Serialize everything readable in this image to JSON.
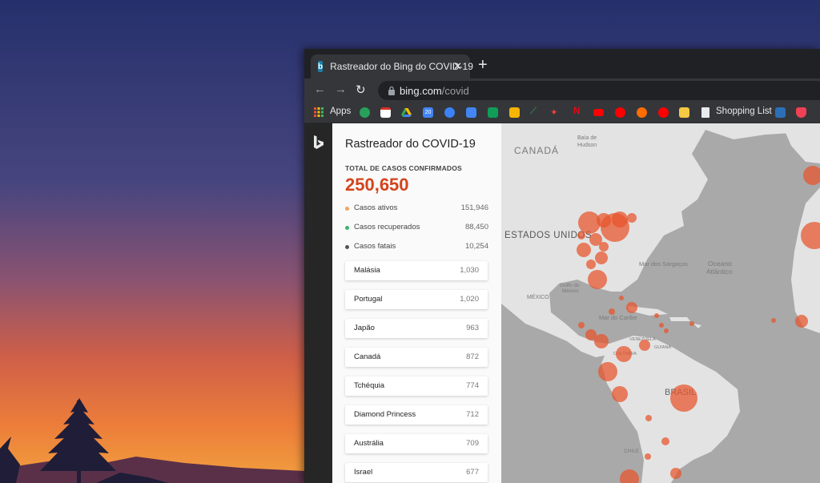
{
  "browser": {
    "tab_title": "Rastreador do Bing do COVID-19",
    "url_host": "bing.com",
    "url_path": "/covid"
  },
  "bookmarks": {
    "apps_label": "Apps",
    "shopping_label": "Shopping List",
    "calendar_day": "20"
  },
  "panel": {
    "title": "Rastreador do COVID-19",
    "total_label": "TOTAL DE CASOS CONFIRMADOS",
    "total_value": "250,650",
    "stats": [
      {
        "label": "Casos ativos",
        "value": "151,946",
        "color": "#f0a35e"
      },
      {
        "label": "Casos recuperados",
        "value": "88,450",
        "color": "#3cb371"
      },
      {
        "label": "Casos fatais",
        "value": "10,254",
        "color": "#555555"
      }
    ],
    "countries": [
      {
        "name": "Malásia",
        "value": "1,030"
      },
      {
        "name": "Portugal",
        "value": "1,020"
      },
      {
        "name": "Japão",
        "value": "963"
      },
      {
        "name": "Canadá",
        "value": "872"
      },
      {
        "name": "Tchéquia",
        "value": "774"
      },
      {
        "name": "Diamond Princess",
        "value": "712"
      },
      {
        "name": "Austrália",
        "value": "709"
      },
      {
        "name": "Israel",
        "value": "677"
      }
    ]
  },
  "map": {
    "labels": {
      "canada": "CANADÁ",
      "baia": "Baía de",
      "hudson": "Hudson",
      "eua": "ESTADOS UNIDOS",
      "sargacos": "Mar dos Sargaços",
      "oceano": "Oceano",
      "atlantico": "Atlântico",
      "golfo1": "Golfo do",
      "golfo2": "México",
      "mexico": "MÉXICO",
      "caribe": "Mar do Caribe",
      "venezuela": "VENEZUELA",
      "guiana": "GUIANA",
      "colombia": "COLÔMBIA",
      "brasil": "BRASIL",
      "chile": "CHILE"
    },
    "colors": {
      "land": "#e3e3e3",
      "water": "#a9a9a9",
      "bubble": "#e8532a"
    }
  }
}
